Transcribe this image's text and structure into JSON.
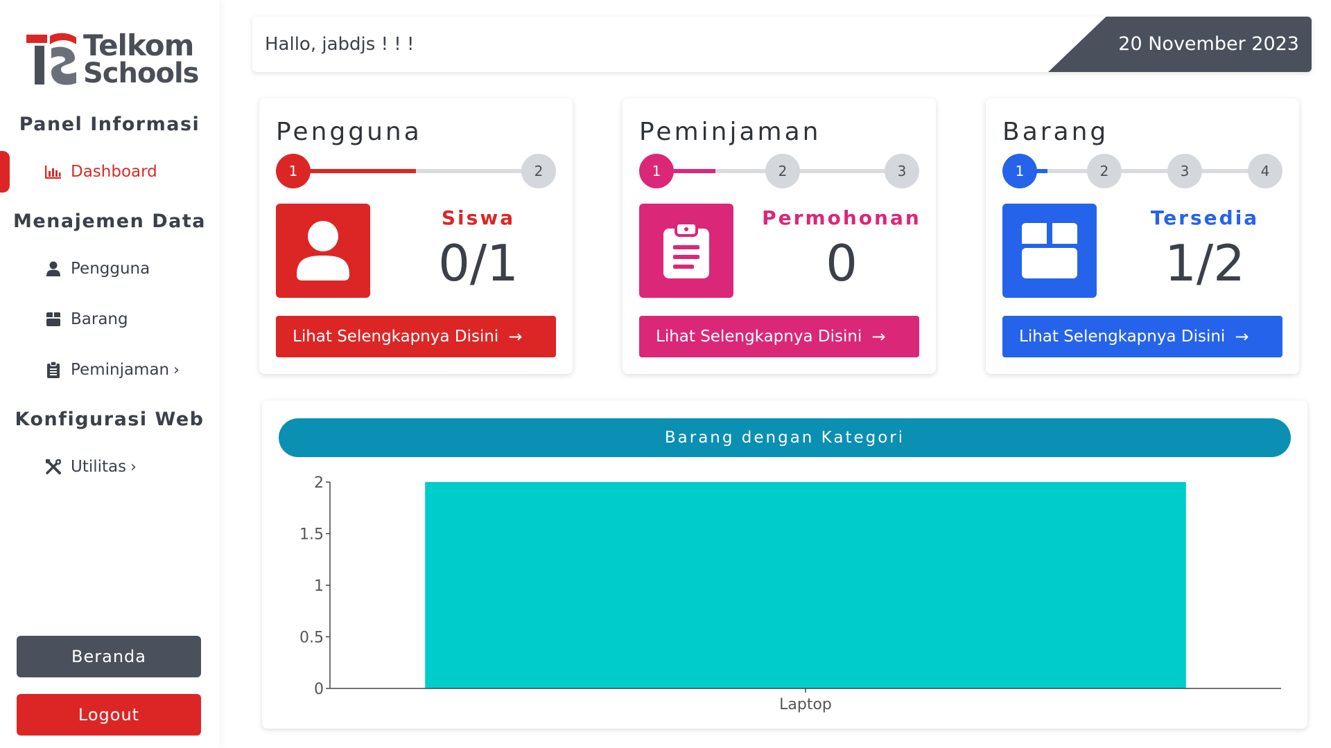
{
  "brand": {
    "line1": "Telkom",
    "line2": "Schools"
  },
  "sidebar": {
    "sections": [
      {
        "heading": "Panel Informasi"
      },
      {
        "heading": "Menajemen Data"
      },
      {
        "heading": "Konfigurasi Web"
      }
    ],
    "items": [
      {
        "label": "Dashboard",
        "icon": "chart-bar-icon",
        "active": true
      },
      {
        "label": "Pengguna",
        "icon": "user-icon"
      },
      {
        "label": "Barang",
        "icon": "box-icon"
      },
      {
        "label": "Peminjaman",
        "icon": "clipboard-icon",
        "chevron": "›"
      },
      {
        "label": "Utilitas",
        "icon": "tools-icon",
        "chevron": "›"
      }
    ],
    "beranda_label": "Beranda",
    "logout_label": "Logout"
  },
  "header": {
    "greeting": "Hallo, jabdjs ! ! !",
    "date": "20 November 2023"
  },
  "cards": [
    {
      "title": "Pengguna",
      "steps": [
        "1",
        "2"
      ],
      "active_step": 1,
      "progress": 0.5,
      "label": "Siswa",
      "value": "0/1",
      "button": "Lihat Selengkapnya Disini",
      "color": "#dc2626",
      "icon": "user-icon"
    },
    {
      "title": "Peminjaman",
      "steps": [
        "1",
        "2",
        "3"
      ],
      "active_step": 1,
      "progress": 0.2,
      "label": "Permohonan",
      "value": "0",
      "button": "Lihat Selengkapnya Disini",
      "color": "#db2777",
      "icon": "clipboard-icon"
    },
    {
      "title": "Barang",
      "steps": [
        "1",
        "2",
        "3",
        "4"
      ],
      "active_step": 1,
      "progress": 0.1,
      "label": "Tersedia",
      "value": "1/2",
      "button": "Lihat Selengkapnya Disini",
      "color": "#2563eb",
      "icon": "box-icon"
    }
  ],
  "chart_section": {
    "title": "Barang dengan Kategori"
  },
  "chart_data": {
    "type": "bar",
    "title": "Barang dengan Kategori",
    "categories": [
      "Laptop"
    ],
    "values": [
      2
    ],
    "ylim": [
      0,
      2
    ],
    "yticks": [
      0,
      0.5,
      1,
      1.5,
      2
    ],
    "ytick_labels": [
      "0",
      "0.5",
      "1",
      "1.5",
      "2"
    ],
    "bar_color": "#00cccc",
    "grid": false
  },
  "colors": {
    "accent_red": "#dc2626",
    "sidebar_dark": "#4a505c",
    "chart_header": "#0b8fb3"
  }
}
